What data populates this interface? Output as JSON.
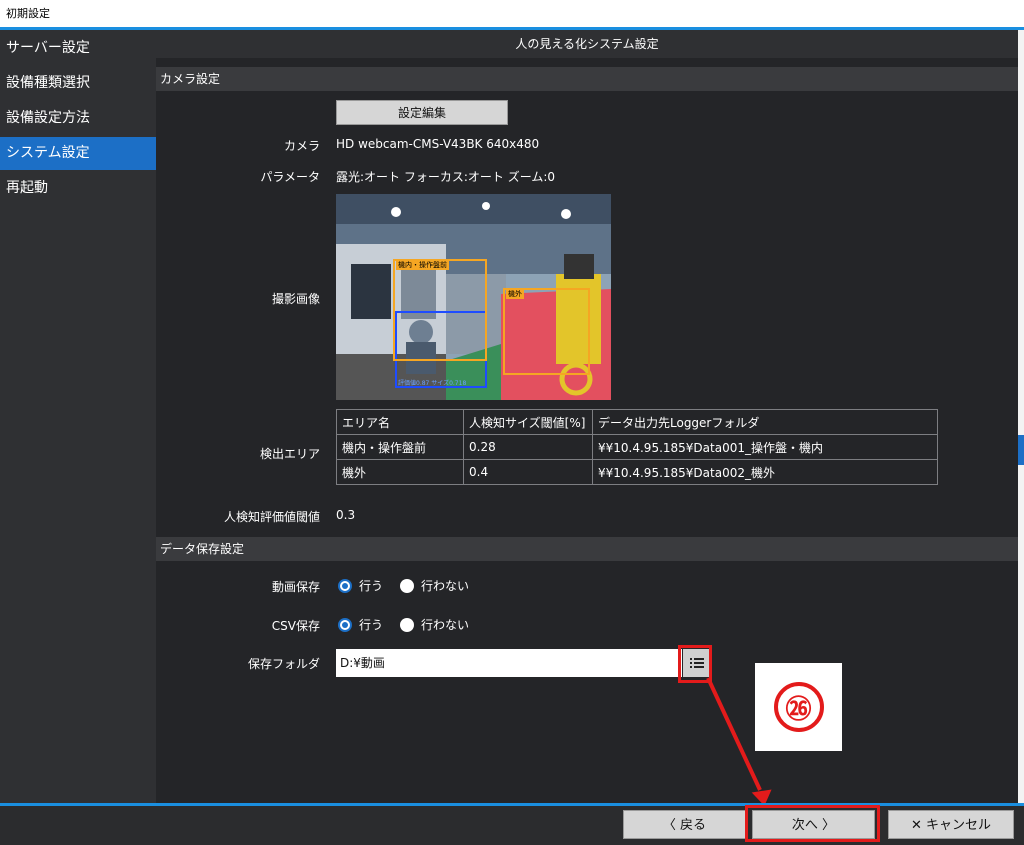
{
  "window": {
    "title": "初期設定"
  },
  "sidebar": {
    "items": [
      {
        "label": "サーバー設定"
      },
      {
        "label": "設備種類選択"
      },
      {
        "label": "設備設定方法"
      },
      {
        "label": "システム設定"
      },
      {
        "label": "再起動"
      }
    ]
  },
  "page": {
    "title": "人の見える化システム設定"
  },
  "camera_section": {
    "title": "カメラ設定",
    "edit_button": "設定編集",
    "camera_label": "カメラ",
    "camera_value": "HD webcam-CMS-V43BK 640x480",
    "param_label": "パラメータ",
    "param_value": "露光:オート フォーカス:オート ズーム:0",
    "image_label": "撮影画像",
    "image_tags": {
      "area1": "機内・操作盤前",
      "area2": "機外",
      "eval": "評価値0.87 サイズ0.718"
    },
    "area_label": "検出エリア",
    "area_table": {
      "headers": [
        "エリア名",
        "人検知サイズ閾値[%]",
        "データ出力先Loggerフォルダ"
      ],
      "rows": [
        [
          "機内・操作盤前",
          "0.28",
          "¥¥10.4.95.185¥Data001_操作盤・機内"
        ],
        [
          "機外",
          "0.4",
          "¥¥10.4.95.185¥Data002_機外"
        ]
      ]
    },
    "threshold_label": "人検知評価値閾値",
    "threshold_value": "0.3"
  },
  "data_section": {
    "title": "データ保存設定",
    "video_label": "動画保存",
    "csv_label": "CSV保存",
    "option_yes": "行う",
    "option_no": "行わない",
    "folder_label": "保存フォルダ",
    "folder_value": "D:¥動画"
  },
  "annotation": {
    "step": "㉖"
  },
  "footer": {
    "back": "〈 戻る",
    "next": "次へ 〉",
    "cancel": "✕ キャンセル"
  },
  "colors": {
    "accent": "#1a8fe0",
    "active": "#1c6fc6",
    "highlight": "#e31b1b"
  }
}
